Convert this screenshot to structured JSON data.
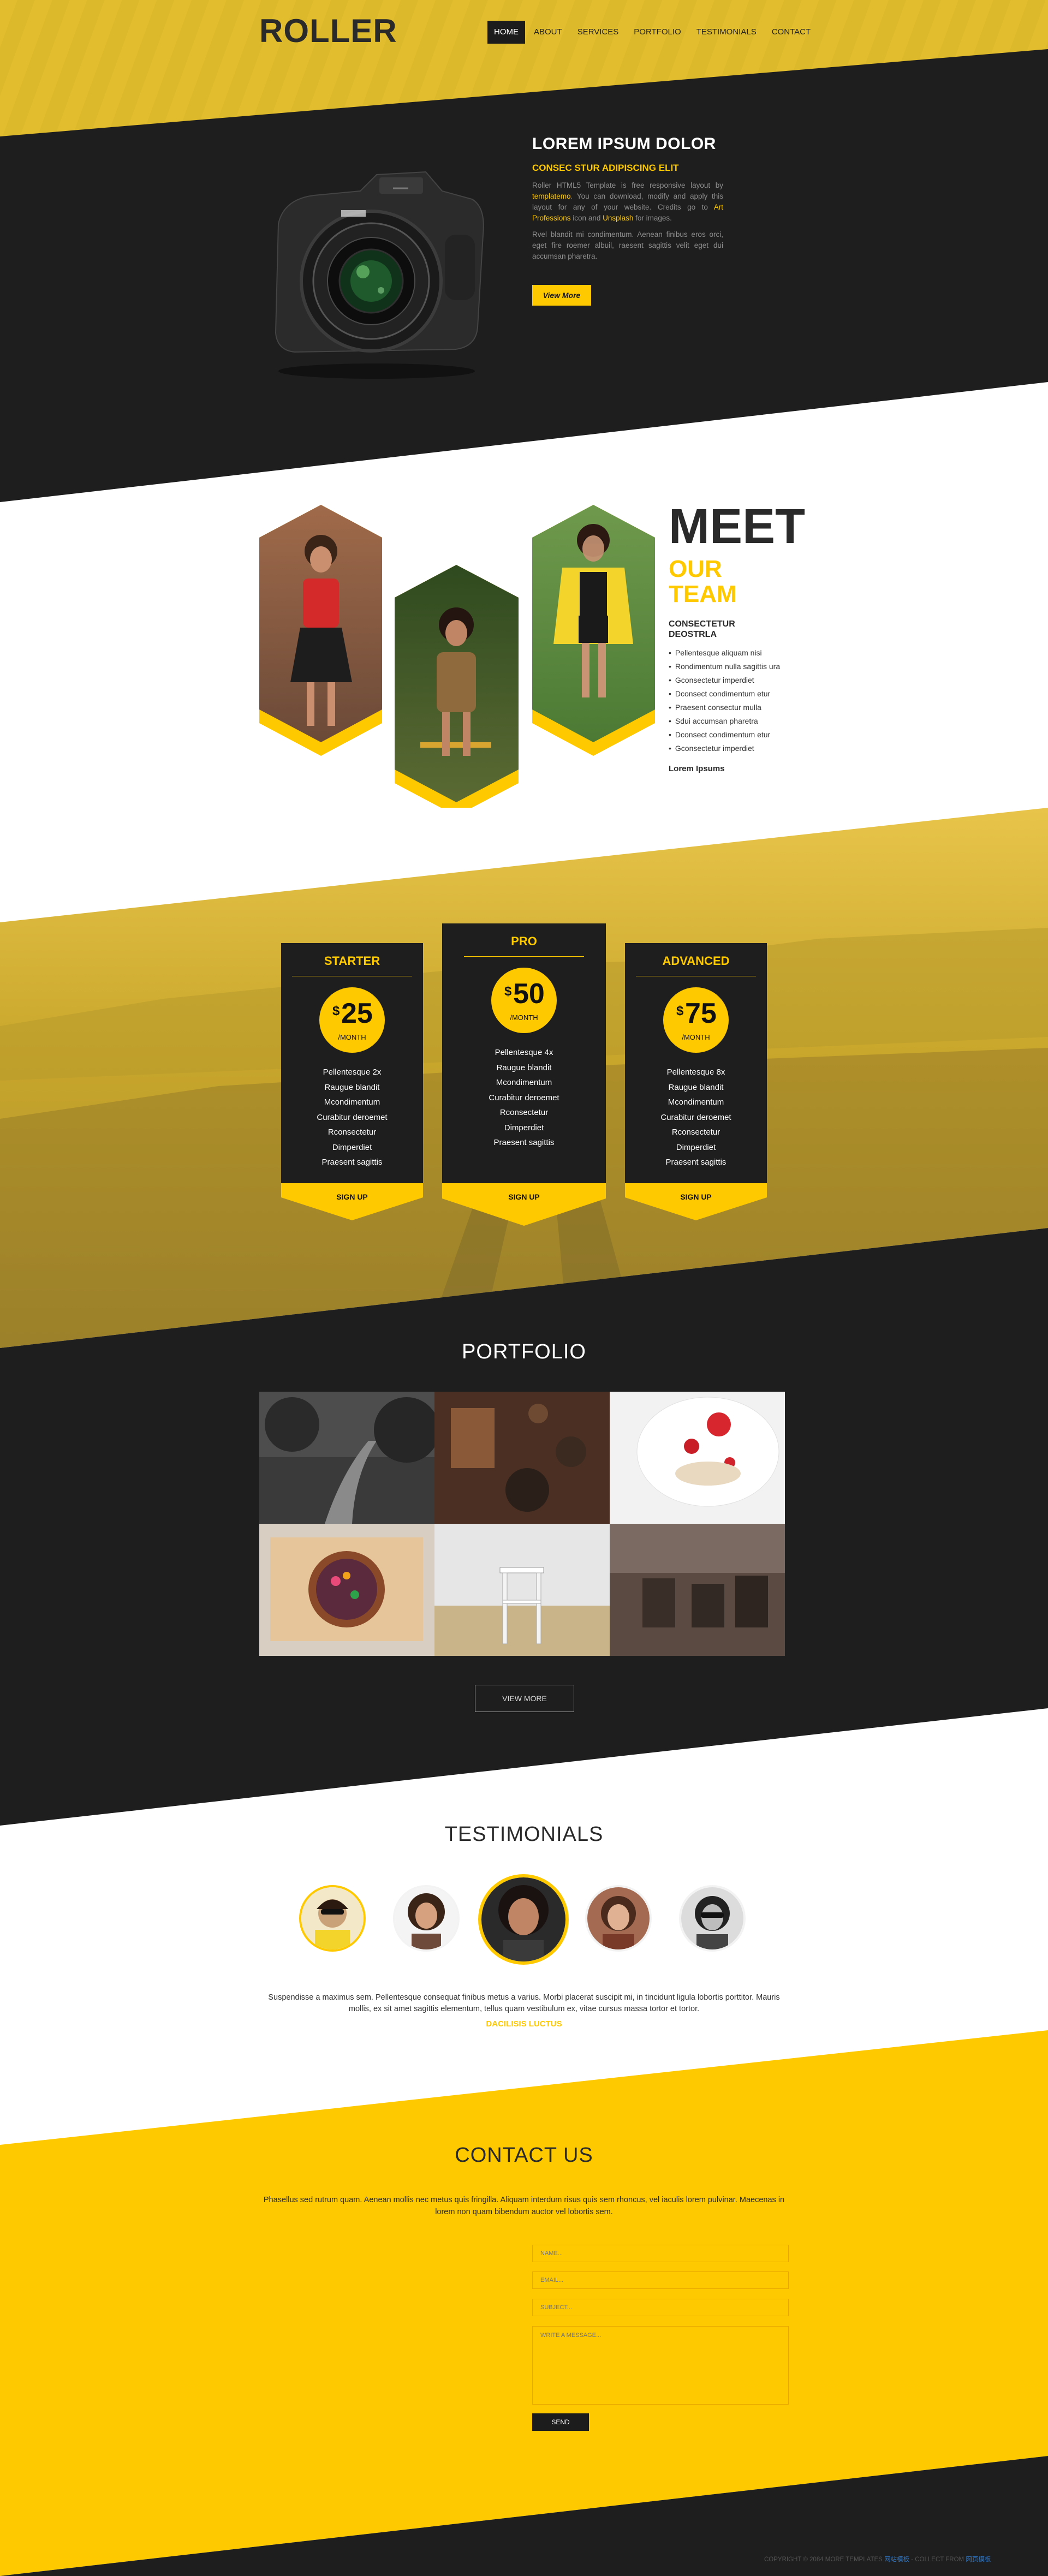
{
  "header": {
    "logo": "ROLLER",
    "nav": [
      "HOME",
      "ABOUT",
      "SERVICES",
      "PORTFOLIO",
      "TESTIMONIALS",
      "CONTACT"
    ]
  },
  "hero": {
    "title": "LOREM IPSUM DOLOR",
    "subtitle": "CONSEC STUR ADIPISCING ELIT",
    "p1_a": "Roller HTML5 Template is free responsive layout by ",
    "p1_link1": "templatemo",
    "p1_b": ". You can download, modify and apply this layout for any of your website. Credits go to ",
    "p1_link2": "Art Professions",
    "p1_c": " icon and ",
    "p1_link3": "Unsplash",
    "p1_d": " for images.",
    "p2": "Rvel blandit mi condimentum. Aenean finibus eros orci, eget fire roemer albuil, raesent sagittis velit eget dui accumsan pharetra.",
    "button": "View More"
  },
  "team": {
    "meet": "MEET",
    "our": "OUR",
    "team": "TEAM",
    "subtitle": "CONSECTETUR DEOSTRLA",
    "items": [
      "Pellentesque aliquam nisi",
      "Rondimentum nulla sagittis ura",
      "Gconsectetur imperdiet",
      "Dconsect condimentum etur",
      "Praesent consectur mulla",
      "Sdui accumsan pharetra",
      "Dconsect condimentum etur",
      "Gconsectetur imperdiet"
    ],
    "signature": "Lorem Ipsums"
  },
  "pricing": {
    "plans": [
      {
        "name": "STARTER",
        "currency": "$",
        "price": "25",
        "period": "/MONTH",
        "features": [
          "Pellentesque 2x",
          "Raugue blandit",
          "Mcondimentum",
          "Curabitur deroemet",
          "Rconsectetur",
          "Dimperdiet",
          "Praesent sagittis"
        ],
        "button": "SIGN UP"
      },
      {
        "name": "PRO",
        "currency": "$",
        "price": "50",
        "period": "/MONTH",
        "features": [
          "Pellentesque 4x",
          "Raugue blandit",
          "Mcondimentum",
          "Curabitur deroemet",
          "Rconsectetur",
          "Dimperdiet",
          "Praesent sagittis"
        ],
        "button": "SIGN UP"
      },
      {
        "name": "ADVANCED",
        "currency": "$",
        "price": "75",
        "period": "/MONTH",
        "features": [
          "Pellentesque 8x",
          "Raugue blandit",
          "Mcondimentum",
          "Curabitur deroemet",
          "Rconsectetur",
          "Dimperdiet",
          "Praesent sagittis"
        ],
        "button": "SIGN UP"
      }
    ]
  },
  "portfolio": {
    "title": "PORTFOLIO",
    "button": "VIEW MORE"
  },
  "testimonials": {
    "title": "TESTIMONIALS",
    "text": "Suspendisse a maximus sem. Pellentesque consequat finibus metus a varius. Morbi placerat suscipit mi, in tincidunt ligula lobortis porttitor. Mauris mollis, ex sit amet sagittis elementum, tellus quam vestibulum ex, vitae cursus massa tortor et tortor.",
    "name": "DACILISIS LUCTUS"
  },
  "contact": {
    "title": "CONTACT US",
    "text": "Phasellus sed rutrum quam. Aenean mollis nec metus quis fringilla. Aliquam interdum risus quis sem rhoncus, vel iaculis lorem pulvinar. Maecenas in lorem non quam bibendum auctor vel lobortis sem.",
    "name_placeholder": "NAME...",
    "email_placeholder": "EMAIL...",
    "subject_placeholder": "SUBJECT...",
    "message_placeholder": "WRITE A MESSAGE...",
    "send": "SEND"
  },
  "footer": {
    "copyright_a": "COPYRIGHT © 2084 MORE TEMPLATES ",
    "copyright_link1": "网站模板",
    "copyright_b": " - COLLECT FROM ",
    "copyright_link2": "网页模板"
  },
  "colors": {
    "accent": "#ffc900",
    "dark": "#1e1e1e",
    "light": "#ffffff"
  }
}
